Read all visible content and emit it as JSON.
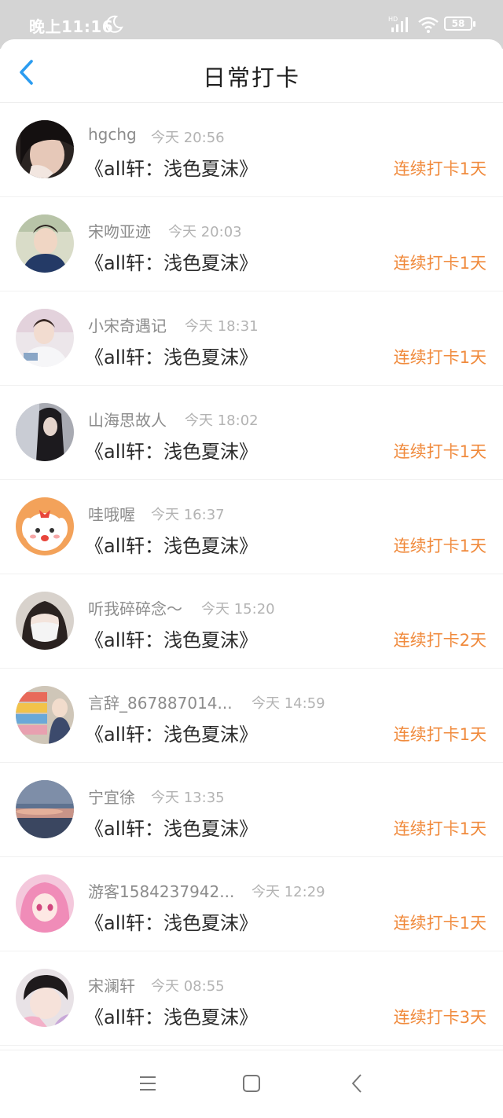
{
  "status_bar": {
    "time": "晚上11:16",
    "battery": "58",
    "icons": [
      "moon-icon",
      "hd-signal-icon",
      "wifi-icon",
      "battery-icon"
    ]
  },
  "header": {
    "title": "日常打卡",
    "back_icon": "chevron-left-icon"
  },
  "colors": {
    "accent": "#f08a3c",
    "back_arrow": "#2b9cf0"
  },
  "entries": [
    {
      "name": "hgchg",
      "time": "今天 20:56",
      "book": "《all轩：浅色夏沫》",
      "streak": "连续打卡1天"
    },
    {
      "name": "宋吻亚迹",
      "time": "今天 20:03",
      "book": "《all轩：浅色夏沫》",
      "streak": "连续打卡1天"
    },
    {
      "name": "小宋奇遇记",
      "time": "今天 18:31",
      "book": "《all轩：浅色夏沫》",
      "streak": "连续打卡1天"
    },
    {
      "name": "山海思故人",
      "time": "今天 18:02",
      "book": "《all轩：浅色夏沫》",
      "streak": "连续打卡1天"
    },
    {
      "name": "哇哦喔",
      "time": "今天 16:37",
      "book": "《all轩：浅色夏沫》",
      "streak": "连续打卡1天"
    },
    {
      "name": "听我碎碎念～",
      "time": "今天 15:20",
      "book": "《all轩：浅色夏沫》",
      "streak": "连续打卡2天"
    },
    {
      "name": "言辞_867887014...",
      "time": "今天 14:59",
      "book": "《all轩：浅色夏沫》",
      "streak": "连续打卡1天"
    },
    {
      "name": "宁宜徐",
      "time": "今天 13:35",
      "book": "《all轩：浅色夏沫》",
      "streak": "连续打卡1天"
    },
    {
      "name": "游客1584237942...",
      "time": "今天 12:29",
      "book": "《all轩：浅色夏沫》",
      "streak": "连续打卡1天"
    },
    {
      "name": "宋澜轩",
      "time": "今天 08:55",
      "book": "《all轩：浅色夏沫》",
      "streak": "连续打卡3天"
    }
  ],
  "nav_bar": {
    "icons": [
      "menu-icon",
      "home-square-icon",
      "back-triangle-icon"
    ]
  }
}
